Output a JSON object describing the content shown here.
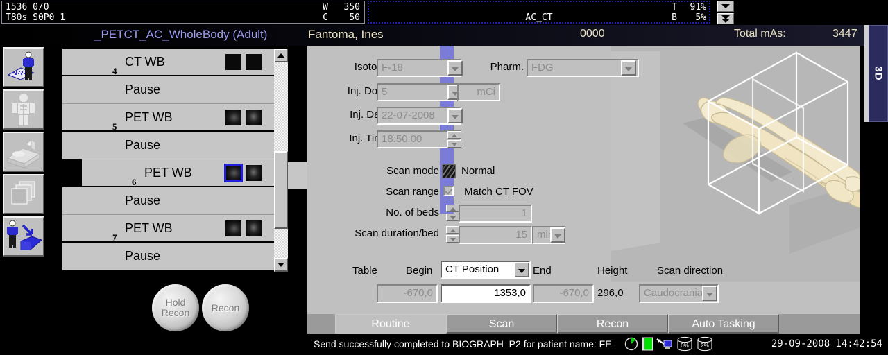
{
  "header": {
    "dicom": {
      "line1": "1536 0/0",
      "line2": "T80s S0P0 1",
      "w_label": "W",
      "w_value": "350",
      "c_label": "C",
      "c_value": "50"
    },
    "ct_pane": {
      "title": "AC_CT",
      "t_label": "T",
      "t_value": "91%",
      "b_label": "B",
      "b_value": "5%"
    },
    "scroll_up_icon": "chevron-down-icon",
    "scroll_down_icon": "double-chevron-down-icon"
  },
  "titlebar": {
    "protocol": "_PETCT_AC_WholeBody (Adult)",
    "patient_name": "Fantoma, Ines",
    "patient_id": "0000",
    "total_mas_label": "Total mAs:",
    "total_mas_value": "3447"
  },
  "right_tab": {
    "label": "3D"
  },
  "sidebar": {
    "items": [
      {
        "name": "patient-registration-icon",
        "label": "Patient Registration"
      },
      {
        "name": "patient-body-icon",
        "label": "Examination"
      },
      {
        "name": "patient-couch-icon",
        "label": "Patient Positioning"
      },
      {
        "name": "image-series-icon",
        "label": "Viewing"
      },
      {
        "name": "patient-transfer-icon",
        "label": "Patient Browser"
      }
    ]
  },
  "protocol_list": {
    "rows": [
      {
        "type": "scan",
        "label": "CT WB",
        "number": "4",
        "thumbs": [
          "ct",
          "ct"
        ],
        "selected": false,
        "thumb_selected": -1
      },
      {
        "type": "pause",
        "label": "Pause",
        "number": "",
        "thumbs": [],
        "selected": false,
        "thumb_selected": -1
      },
      {
        "type": "scan",
        "label": "PET WB",
        "number": "5",
        "thumbs": [
          "pet",
          "pet2"
        ],
        "selected": false,
        "thumb_selected": -1
      },
      {
        "type": "pause",
        "label": "Pause",
        "number": "",
        "thumbs": [],
        "selected": false,
        "thumb_selected": -1
      },
      {
        "type": "scan",
        "label": "PET WB",
        "number": "6",
        "thumbs": [
          "pet",
          "pet2"
        ],
        "selected": true,
        "thumb_selected": 0
      },
      {
        "type": "pause",
        "label": "Pause",
        "number": "",
        "thumbs": [],
        "selected": false,
        "thumb_selected": -1
      },
      {
        "type": "scan",
        "label": "PET WB",
        "number": "7",
        "thumbs": [
          "pet",
          "pet2"
        ],
        "selected": false,
        "thumb_selected": -1
      },
      {
        "type": "pause",
        "label": "Pause",
        "number": "",
        "thumbs": [],
        "selected": false,
        "thumb_selected": -1
      }
    ],
    "scroll_up_icon": "triangle-up-icon",
    "scroll_down_icon": "triangle-down-icon"
  },
  "round_buttons": {
    "hold_recon_line1": "Hold",
    "hold_recon_line2": "Recon",
    "recon": "Recon"
  },
  "form": {
    "isotope_label": "Isotope",
    "isotope_value": "F-18",
    "pharm_label": "Pharm.",
    "pharm_value": "FDG",
    "inj_dose_label": "Inj. Dose",
    "inj_dose_value": "5",
    "inj_dose_unit": "mCi",
    "inj_date_label": "Inj. Date",
    "inj_date_value": "22-07-2008",
    "inj_time_label": "Inj. Time",
    "inj_time_value": "18:50:00",
    "scan_mode_label": "Scan mode",
    "scan_mode_value": "Normal",
    "scan_range_label": "Scan range",
    "scan_range_value": "Match CT FOV",
    "no_of_beds_label": "No. of beds",
    "no_of_beds_value": "1",
    "scan_duration_label": "Scan duration/bed",
    "scan_duration_value": "15",
    "scan_duration_unit": "min",
    "table_label": "Table",
    "begin_label": "Begin",
    "begin_mode": "CT Position",
    "end_label": "End",
    "height_label": "Height",
    "scan_direction_label": "Scan direction",
    "begin_value": "-670,0",
    "position_value": "1353,0",
    "end_value": "-670,0",
    "height_value": "296,0",
    "scan_direction_value": "Caudocranial"
  },
  "tabs": [
    {
      "label": "Routine",
      "active": true
    },
    {
      "label": "Scan",
      "active": false
    },
    {
      "label": "Recon",
      "active": false
    },
    {
      "label": "Auto Tasking",
      "active": false
    }
  ],
  "statusbar": {
    "message": "Send successfully completed to BIOGRAPH_P2 for patient name: FE",
    "datetime": "29-09-2008 14:42:54",
    "icons": [
      {
        "name": "pie-progress-icon",
        "text": ""
      },
      {
        "name": "memory-bar-icon",
        "text": ""
      },
      {
        "name": "network-host-icon",
        "text": ""
      },
      {
        "name": "disk-usage-icon",
        "text": "0%"
      },
      {
        "name": "disk-usage-2-icon",
        "text": "2%"
      }
    ]
  },
  "colors": {
    "panel_gray": "#c0c0c0",
    "accent_blue": "#7b7bd8",
    "selection_blue": "#2020dd",
    "title_purple": "#9c9cf0",
    "title_cream": "#e8e0c0"
  }
}
